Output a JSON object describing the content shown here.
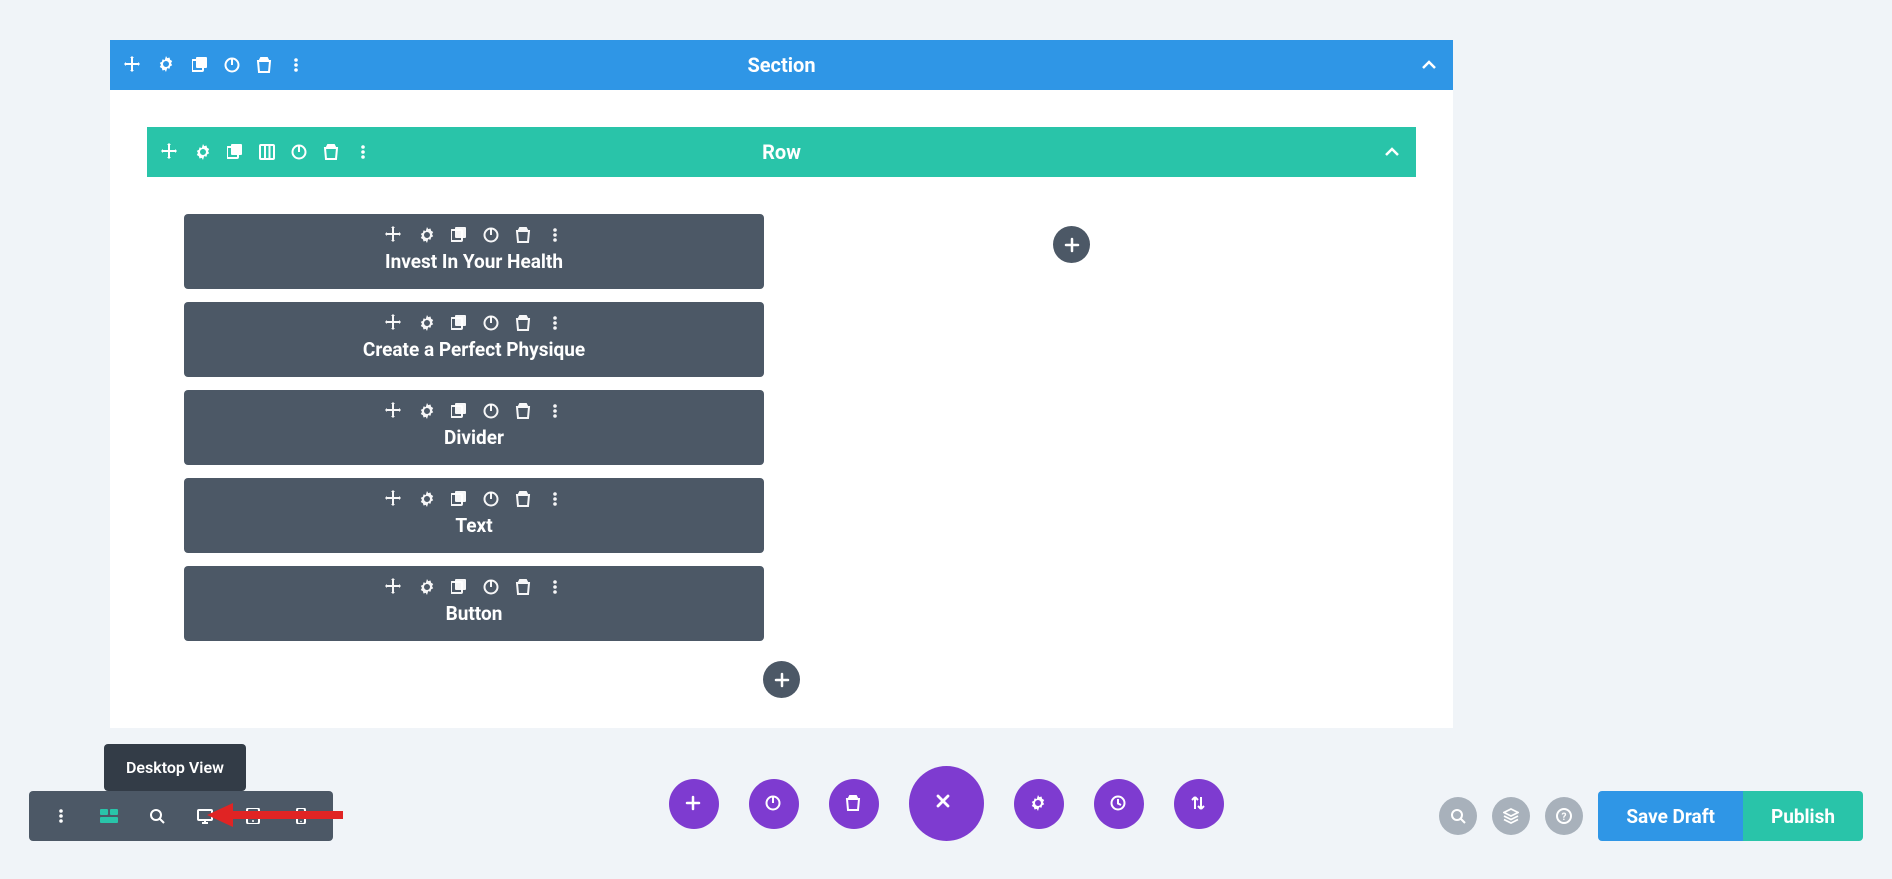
{
  "section": {
    "label": "Section"
  },
  "row": {
    "label": "Row"
  },
  "modules": [
    {
      "label": "Invest In Your Health"
    },
    {
      "label": "Create a Perfect Physique"
    },
    {
      "label": "Divider"
    },
    {
      "label": "Text"
    },
    {
      "label": "Button"
    }
  ],
  "tooltip": {
    "label": "Desktop View"
  },
  "actions": {
    "save_draft": "Save Draft",
    "publish": "Publish"
  },
  "colors": {
    "section": "#2F96E6",
    "row": "#29C4A9",
    "module": "#4C5866",
    "purple": "#7E3BD0"
  }
}
